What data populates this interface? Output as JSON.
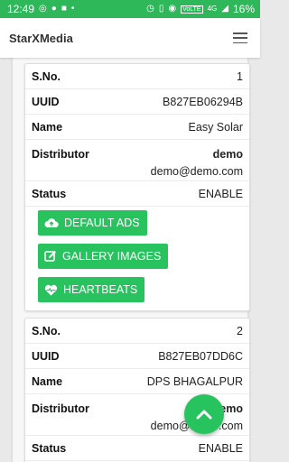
{
  "status_bar": {
    "time": "12:49",
    "icons": [
      "whatsapp-icon",
      "message-icon",
      "w-app-icon",
      "dot-icon",
      "alarm-icon",
      "vibrate-icon",
      "hotspot-icon",
      "volte-icon",
      "signal-icon",
      "battery-icon"
    ],
    "volte": "VoLTE",
    "network": "4G",
    "battery": "16%"
  },
  "navbar": {
    "title": "StarXMedia"
  },
  "labels": {
    "sno": "S.No.",
    "uuid": "UUID",
    "name": "Name",
    "distributor": "Distributor",
    "status": "Status"
  },
  "records": [
    {
      "sno": "1",
      "uuid": "B827EB06294B",
      "name": "Easy Solar",
      "distributor_name": "demo",
      "distributor_email": "demo@demo.com",
      "status": "ENABLE",
      "buttons": [
        "DEFAULT ADS",
        "GALLERY IMAGES",
        "HEARTBEATS"
      ]
    },
    {
      "sno": "2",
      "uuid": "B827EB07DD6C",
      "name": "DPS BHAGALPUR",
      "distributor_name": "demo",
      "distributor_email": "demo@demo.com",
      "status": "ENABLE"
    }
  ],
  "colors": {
    "primary_green": "#2fb85a",
    "button_green": "#28c35f"
  }
}
